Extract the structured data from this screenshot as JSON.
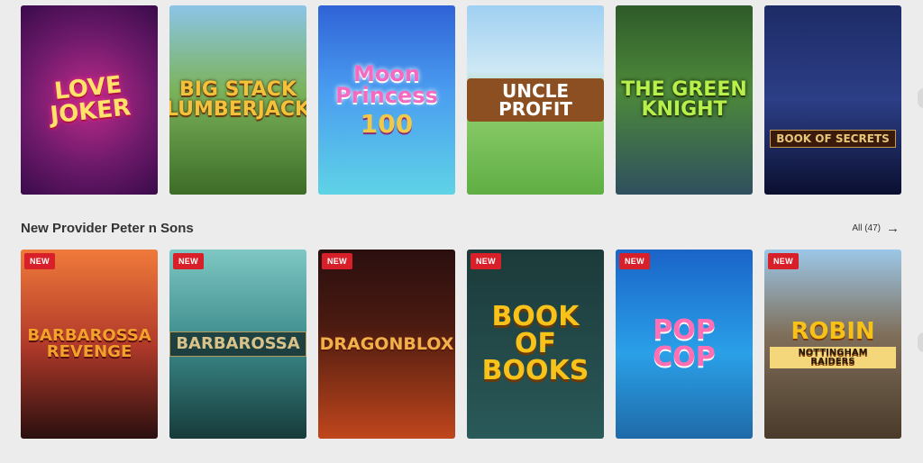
{
  "section": {
    "title": "New Provider Peter n Sons",
    "see_all_label": "All (47)"
  },
  "badges": {
    "new": "NEW"
  },
  "top_row": [
    {
      "name": "LOVE JOKER"
    },
    {
      "name": "BIG STACK LUMBERJACK"
    },
    {
      "name": "Moon Princess",
      "sub": "100"
    },
    {
      "name": "UNCLE PROFIT"
    },
    {
      "name": "THE GREEN KNIGHT"
    },
    {
      "name": "BOOK OF SECRETS"
    }
  ],
  "bottom_row": [
    {
      "name": "BARBAROSSA REVENGE"
    },
    {
      "name": "BARBAROSSA"
    },
    {
      "name": "DRAGONBLOX"
    },
    {
      "name": "BOOK OF BOOKS"
    },
    {
      "name": "POP COP"
    },
    {
      "name": "ROBIN",
      "sub": "NOTTINGHAM RAIDERS"
    }
  ],
  "colors": {
    "badge": "#d8202a",
    "page_background": "#ececec"
  },
  "icons": {
    "see_all": "arrow-right-icon",
    "carousel_next": "chevron-right-icon"
  }
}
